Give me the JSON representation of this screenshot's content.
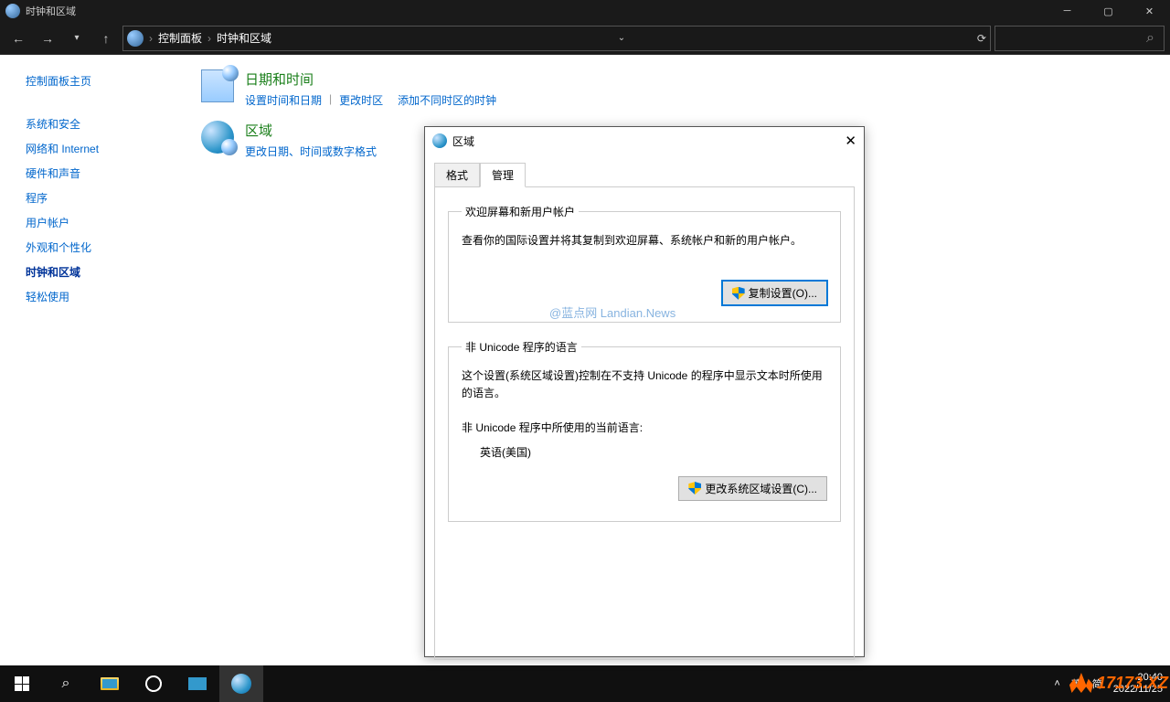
{
  "titlebar": {
    "title": "时钟和区域"
  },
  "address": {
    "root": "控制面板",
    "current": "时钟和区域"
  },
  "sidebar": {
    "header": "控制面板主页",
    "items": [
      "系统和安全",
      "网络和 Internet",
      "硬件和声音",
      "程序",
      "用户帐户",
      "外观和个性化",
      "时钟和区域",
      "轻松使用"
    ]
  },
  "main": {
    "cat1": {
      "title": "日期和时间",
      "links": [
        "设置时间和日期",
        "更改时区",
        "添加不同时区的时钟"
      ]
    },
    "cat2": {
      "title": "区域",
      "links": [
        "更改日期、时间或数字格式"
      ]
    }
  },
  "dialog": {
    "title": "区域",
    "tabs": [
      "格式",
      "管理"
    ],
    "group1": {
      "legend": "欢迎屏幕和新用户帐户",
      "desc": "查看你的国际设置并将其复制到欢迎屏幕、系统帐户和新的用户帐户。",
      "watermark": "@蓝点网 Landian.News",
      "button": "复制设置(O)..."
    },
    "group2": {
      "legend": "非 Unicode 程序的语言",
      "desc": "这个设置(系统区域设置)控制在不支持 Unicode 的程序中显示文本时所使用的语言。",
      "label": "非 Unicode 程序中所使用的当前语言:",
      "value": "英语(美国)",
      "button": "更改系统区域设置(C)..."
    }
  },
  "taskbar": {
    "tray": {
      "lang1": "英",
      "lang2": "简",
      "time": "20:40",
      "date": "2022/11/25"
    },
    "brand": "17173.XZ"
  }
}
